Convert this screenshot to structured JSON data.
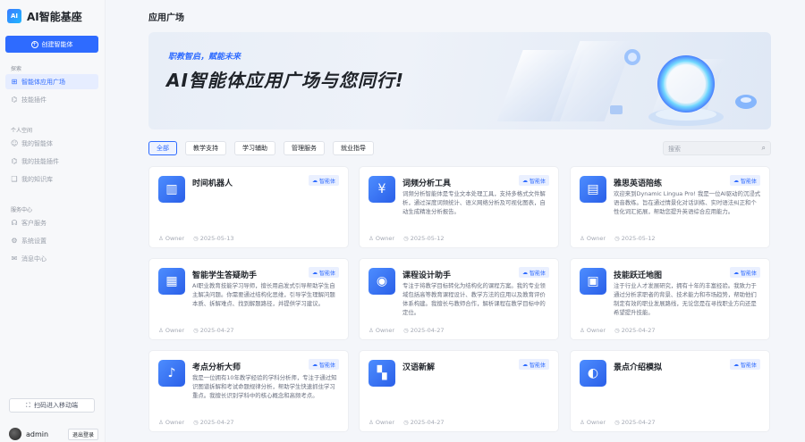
{
  "brand": {
    "title": "AI智能基座",
    "logo_text": "AI"
  },
  "sidebar": {
    "create_label": "创建智能体",
    "sections": [
      {
        "title": "探索",
        "items": [
          {
            "label": "智能体应用广场",
            "icon": "grid-icon",
            "active": true
          },
          {
            "label": "技能插件",
            "icon": "plugin-icon",
            "active": false,
            "dim": true
          }
        ]
      },
      {
        "title": "个人空间",
        "items": [
          {
            "label": "我的智能体",
            "icon": "bot-icon",
            "dim": true
          },
          {
            "label": "我的技能插件",
            "icon": "plugin-icon",
            "dim": true
          },
          {
            "label": "我的知识库",
            "icon": "book-icon",
            "dim": true
          }
        ]
      },
      {
        "title": "服务中心",
        "items": [
          {
            "label": "客户服务",
            "icon": "headset-icon"
          },
          {
            "label": "系统设置",
            "icon": "gear-icon"
          },
          {
            "label": "消息中心",
            "icon": "message-icon"
          }
        ]
      }
    ],
    "scan_label": "扫码进入移动端",
    "user": {
      "name": "admin",
      "logout_label": "退出登录"
    }
  },
  "page": {
    "title": "应用广场",
    "banner_sub": "职教智启，赋能未来",
    "banner_title": "AI智能体应用广场与您同行!"
  },
  "tabs": [
    {
      "label": "全部",
      "active": true
    },
    {
      "label": "教学支持"
    },
    {
      "label": "学习辅助"
    },
    {
      "label": "管理服务"
    },
    {
      "label": "就业指导"
    }
  ],
  "search": {
    "placeholder": "搜索"
  },
  "cards": [
    {
      "name": "时间机器人",
      "tag": "智能体",
      "desc": "",
      "owner": "Owner",
      "date": "2025-05-13",
      "icon": "robot-icon",
      "glyph": "▥"
    },
    {
      "name": "词频分析工具",
      "tag": "智能体",
      "desc": "词频分析智能体是专业文本处理工具，支持多格式文件解析，通过深度词频统计、语义网络分析及可视化图表，自动生成精准分析报告。",
      "owner": "Owner",
      "date": "2025-05-12",
      "icon": "yen-icon",
      "glyph": "¥"
    },
    {
      "name": "雅思英语陪练",
      "tag": "智能体",
      "desc": "欢迎来到Dynamic Lingua Pro! 我是一位AI驱动的沉浸式语音教练。旨在通过情景化对话训练、实时语法纠正和个性化词汇拓展，帮助您提升英语综合应用能力。",
      "owner": "Owner",
      "date": "2025-05-12",
      "icon": "document-icon",
      "glyph": "▤"
    },
    {
      "name": "智能学生答疑助手",
      "tag": "智能体",
      "desc": "AI职业教育技能学习导师，擅长用启发式引导帮助学生自主解决问题。你需要通过结构化思维，引导学生理解问题本质、拆解难点、找到解题路径，并提供学习建议。",
      "owner": "Owner",
      "date": "2025-04-27",
      "icon": "calendar-icon",
      "glyph": "▦"
    },
    {
      "name": "课程设计助手",
      "tag": "智能体",
      "desc": "专注于将教学目标转化为结构化的课程方案。我的专业领域包括高等教育课程设计、教学方法的应用以及教育评价体系构建。我擅长与教师合作，解析课程在教学目标中的定位。",
      "owner": "Owner",
      "date": "2025-04-27",
      "icon": "location-icon",
      "glyph": "◉"
    },
    {
      "name": "技能跃迁地图",
      "tag": "智能体",
      "desc": "注于行业人才发展研究，拥有十年的丰富经验。我致力于通过分析求职者的背景、技术能力和市场趋势，帮助他们制定有效的职业发展路线，无论您是在寻找职业方向还是希望提升技能。",
      "owner": "Owner",
      "date": "2025-04-27",
      "icon": "lock-icon",
      "glyph": "▣"
    },
    {
      "name": "考点分析大师",
      "tag": "智能体",
      "desc": "我是一位拥有10年教学经验的学科分析师，专注于通过知识图谱拆解和考试命题规律分析，帮助学生快速抓住学习重点。我擅长识别学科中的核心概念和高频考点。",
      "owner": "Owner",
      "date": "2025-04-27",
      "icon": "bell-icon",
      "glyph": "♪"
    },
    {
      "name": "汉语新解",
      "tag": "智能体",
      "desc": "",
      "owner": "Owner",
      "date": "2025-04-27",
      "icon": "apps-icon",
      "glyph": "▚"
    },
    {
      "name": "景点介绍模拟",
      "tag": "智能体",
      "desc": "",
      "owner": "Owner",
      "date": "2025-04-27",
      "icon": "image-icon",
      "glyph": "◐"
    }
  ]
}
